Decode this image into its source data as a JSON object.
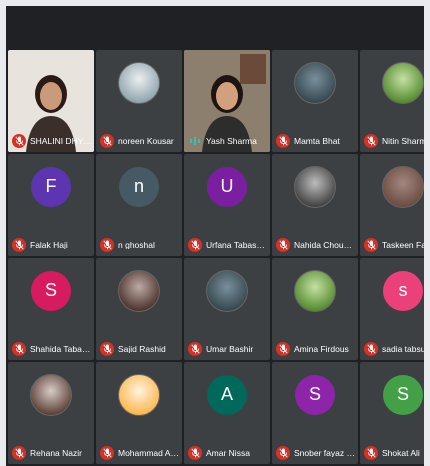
{
  "participants": [
    {
      "name": "SHALINI DHYANI",
      "type": "video",
      "mic": "muted"
    },
    {
      "name": "noreen Kousar",
      "type": "photo",
      "mic": "muted"
    },
    {
      "name": "Yash Sharma",
      "type": "video",
      "mic": "speaking"
    },
    {
      "name": "Mamta Bhat",
      "type": "photo",
      "mic": "muted"
    },
    {
      "name": "Nitin Sharma",
      "type": "photo",
      "mic": "muted"
    },
    {
      "name": "Falak Haji",
      "type": "initial",
      "initial": "F",
      "color": "#5e35b1",
      "mic": "muted"
    },
    {
      "name": "n ghoshal",
      "type": "initial",
      "initial": "n",
      "color": "#455a64",
      "mic": "muted"
    },
    {
      "name": "Urfana Tabassum",
      "type": "initial",
      "initial": "U",
      "color": "#7b1fa2",
      "mic": "muted"
    },
    {
      "name": "Nahida Choudhary",
      "type": "photo",
      "mic": "muted"
    },
    {
      "name": "Taskeen Fatima",
      "type": "photo",
      "mic": "muted"
    },
    {
      "name": "Shahida Tabassum",
      "type": "initial",
      "initial": "S",
      "color": "#d81b60",
      "mic": "muted"
    },
    {
      "name": "Sajid Rashid",
      "type": "photo",
      "mic": "muted"
    },
    {
      "name": "Umar Bashir",
      "type": "photo",
      "mic": "muted"
    },
    {
      "name": "Amina Firdous",
      "type": "photo",
      "mic": "muted"
    },
    {
      "name": "sadia tabsum",
      "type": "initial",
      "initial": "s",
      "color": "#ec407a",
      "mic": "muted"
    },
    {
      "name": "Rehana Nazir",
      "type": "photo",
      "mic": "muted"
    },
    {
      "name": "Mohammad Adrees",
      "type": "photo",
      "mic": "muted"
    },
    {
      "name": "Amar Nissa",
      "type": "initial",
      "initial": "A",
      "color": "#00695c",
      "mic": "muted"
    },
    {
      "name": "Snober fayaz Lone",
      "type": "initial",
      "initial": "S",
      "color": "#8e24aa",
      "mic": "muted"
    },
    {
      "name": "Shokat Ali",
      "type": "initial",
      "initial": "S",
      "color": "#43a047",
      "mic": "muted"
    }
  ],
  "colors": {
    "tile_bg": "#3c4043",
    "mic_muted": "#d93025",
    "speaking_indicator": "#2ec4b6"
  }
}
